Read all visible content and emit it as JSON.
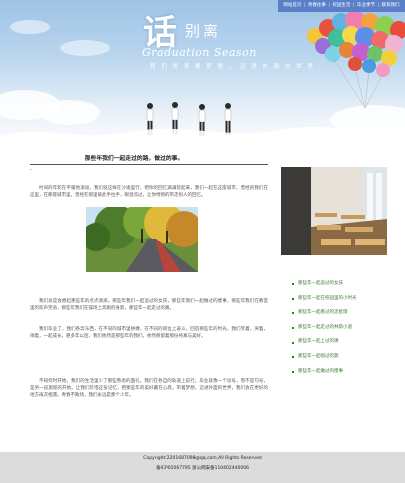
{
  "header": {
    "nav": [
      "网站首页",
      "青春往事",
      "校园生活",
      "毕业季节",
      "联系我们"
    ],
    "title_zh_main": "话",
    "title_zh_rest": "别离",
    "title_en": "Graduation Season",
    "tagline": "我 们 将 承 载 梦 想 ， 迈 进 外 面 的 世 界",
    "tagline_sub": "我 们 将 承 载 梦 想\n迈 进 外 面 的 世 界"
  },
  "article": {
    "title": "那些年我们一起走过的路，做过的事。",
    "dash": "-",
    "paragraphs": [
      "时间的年轮在平缓地滚动，我们就这样在沙滩里行，把你的回忆满满装起来，我们一起在这座城市，曾经的我们在这里，在那座城市里，曾经在那里彼此手拉手，眼泪流过，让你悄悄的带走别人的回忆。",
      "我们总是会想起那些年的点点滴滴，那些年我们一起追过的女孩，那些年我们一起做过的傻事，那些年我们在教室里的欢声笑语，那些年我们在操场上奔跑的身影，那些年一起走过的路。",
      "我们毕业了，我们各奔东西，在不同的城市里拼搏，在不同的岗位上奋斗。回首那些年的时光，我们笑着，哭着，闹着，一起成长。愿多年以后，我们依然是那些年的我们，依然保留着那份纯真与美好。",
      "不知何时开始，我们的生活里少了那些熟悉的面孔，我们在各自的轨道上前行。毕业就像一个逗号，而不是句号，是另一段旅程的开始。让我们珍惜这份记忆，把那些年的美好藏在心底，带着梦想，迈进外面的世界，我们会在更好的地方再次相遇。青春不散场，我们永远是那个少年。"
    ]
  },
  "sidebar": {
    "links": [
      "那些年一起追过的女孩",
      "那些年一起在校园里的小时光",
      "那些年一起看过的流星雨",
      "那些年一起走过的林荫小道",
      "那些年一起上过的课",
      "那些年一起唱过的歌",
      "那些年一起做过的傻事"
    ]
  },
  "footer": {
    "copyright": "Copyright:2201687098@qq.com,All Rights Reserved",
    "icp": "备ICP05067795 浙公网安备110402440006"
  },
  "colors": {
    "nav_bg": "#5b7fc9",
    "link_green": "#3a7a2e",
    "footer_bg": "#dcdcdc"
  },
  "icons": [
    "balloons-illustration",
    "graduates-illustration",
    "wave-decoration"
  ]
}
